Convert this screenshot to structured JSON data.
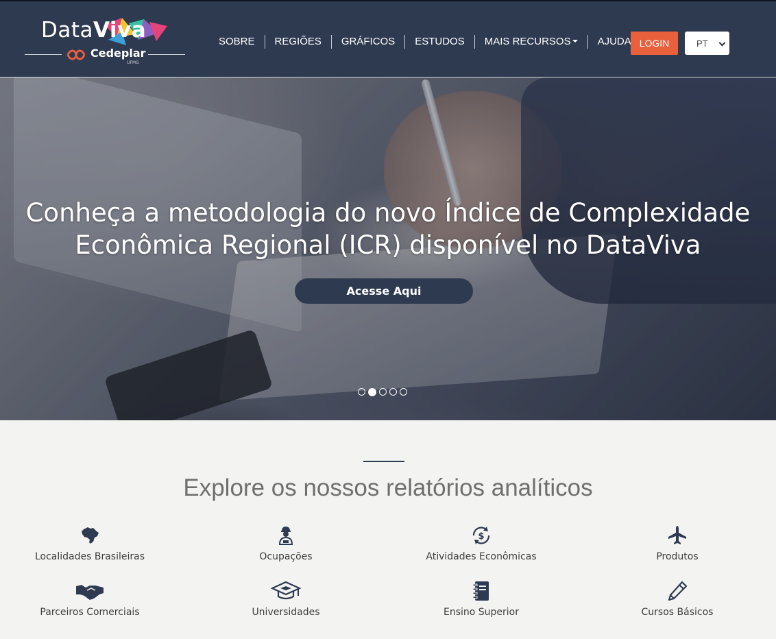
{
  "header": {
    "logo": {
      "brand_main": "Data",
      "brand_accent": "Viva",
      "partner": "Cedeplar",
      "partner_sub": "UFMG"
    },
    "nav": [
      {
        "label": "SOBRE"
      },
      {
        "label": "REGIÕES"
      },
      {
        "label": "GRÁFICOS"
      },
      {
        "label": "ESTUDOS"
      },
      {
        "label": "MAIS RECURSOS",
        "has_dropdown": true
      },
      {
        "label": "AJUDA"
      }
    ],
    "login_label": "LOGIN",
    "language": {
      "selected": "PT"
    }
  },
  "hero": {
    "title_line1": "Conheça a metodologia do novo Índice de Complexidade",
    "title_line2": "Econômica Regional (ICR) disponível no DataViva",
    "button_label": "Acesse Aqui",
    "carousel": {
      "slide_count": 5,
      "active_slide": 2
    }
  },
  "explore": {
    "title": "Explore os nossos relatórios analíticos",
    "categories": [
      {
        "label": "Localidades Brasileiras",
        "icon": "brazil-map-icon"
      },
      {
        "label": "Ocupações",
        "icon": "worker-icon"
      },
      {
        "label": "Atividades Econômicas",
        "icon": "dollar-cycle-icon"
      },
      {
        "label": "Produtos",
        "icon": "airplane-icon"
      },
      {
        "label": "Parceiros Comerciais",
        "icon": "handshake-icon"
      },
      {
        "label": "Universidades",
        "icon": "graduation-cap-icon"
      },
      {
        "label": "Ensino Superior",
        "icon": "notebook-icon"
      },
      {
        "label": "Cursos Básicos",
        "icon": "pencil-icon"
      }
    ]
  },
  "colors": {
    "header_bg": "#2e3a50",
    "login_bg": "#e8603c",
    "page_bg": "#f3f4f2",
    "icon_color": "#2e3a50"
  }
}
